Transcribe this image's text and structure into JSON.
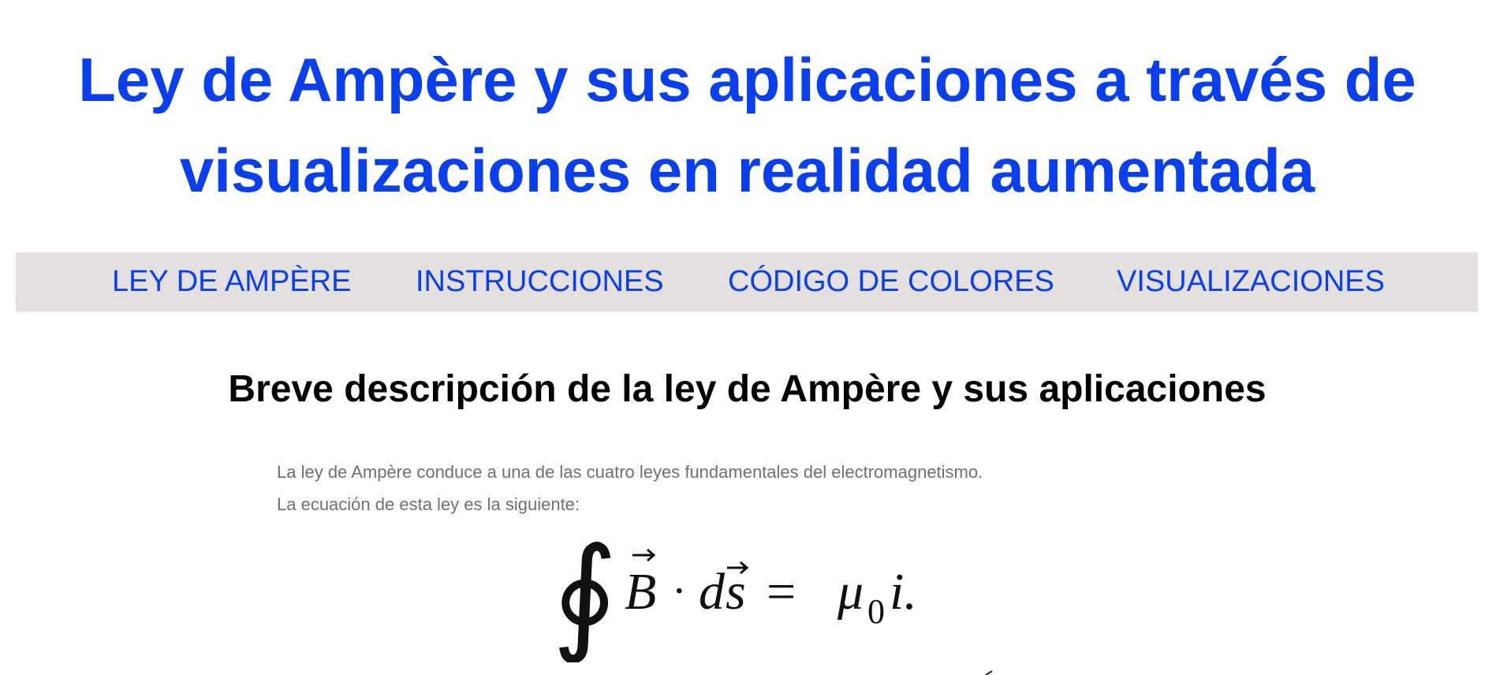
{
  "header": {
    "title_line1": "Ley de Ampère y sus aplicaciones a través de",
    "title_line2": "visualizaciones en realidad aumentada"
  },
  "nav": {
    "items": [
      {
        "label": "LEY DE AMPÈRE"
      },
      {
        "label": "INSTRUCCIONES"
      },
      {
        "label": "CÓDIGO DE COLORES"
      },
      {
        "label": "VISUALIZACIONES"
      }
    ]
  },
  "content": {
    "heading": "Breve descripción de la ley de Ampère y sus aplicaciones",
    "paragraph1": "La ley de Ampère conduce a una de las cuatro leyes fundamentales del electromagnetismo.",
    "paragraph2": "La ecuación de esta ley es la siguiente:",
    "equation": {
      "integral": "∮",
      "field": "B",
      "dot": "·",
      "differential": "d",
      "path": "s",
      "equals": "=",
      "mu": "μ",
      "subscript": "0",
      "current": "i."
    }
  },
  "colors": {
    "accent": "#0a3ff0",
    "nav_background": "#e4e0e0",
    "body_text": "#707070",
    "heading_text": "#000000"
  }
}
